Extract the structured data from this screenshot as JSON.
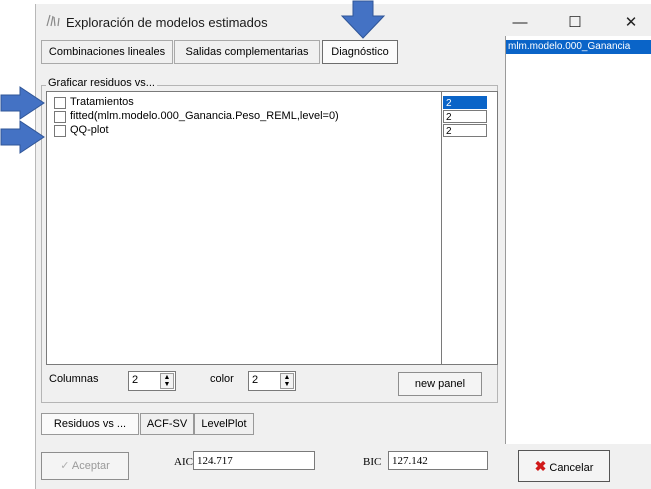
{
  "window": {
    "title": "Exploración de modelos estimados",
    "icon": "app-icon",
    "controls": {
      "minimize": "—",
      "maximize": "☐",
      "close": "✕"
    }
  },
  "tabs": [
    {
      "label": "Combinaciones lineales",
      "active": false
    },
    {
      "label": "Salidas complementarias",
      "active": false
    },
    {
      "label": "Diagnóstico",
      "active": true
    }
  ],
  "models_list": {
    "items": [
      "mlm.modelo.000_Ganancia"
    ],
    "selected_index": 0
  },
  "group": {
    "label": "Graficar residuos vs...",
    "items": [
      {
        "label": "Tratamientos",
        "checked": false
      },
      {
        "label": "fitted(mlm.modelo.000_Ganancia.Peso_REML,level=0)",
        "checked": false
      },
      {
        "label": "QQ-plot",
        "checked": false
      }
    ],
    "side_values": [
      "2",
      "2",
      "2"
    ]
  },
  "options": {
    "columnas_label": "Columnas",
    "columnas_value": "2",
    "color_label": "color",
    "color_value": "2",
    "new_panel_label": "new panel"
  },
  "bottom_tabs": [
    {
      "label": "Residuos vs ...",
      "active": true
    },
    {
      "label": "ACF-SV",
      "active": false
    },
    {
      "label": "LevelPlot",
      "active": false
    }
  ],
  "footer": {
    "accept_label": "Aceptar",
    "aic_label": "AIC",
    "aic_value": "124.717",
    "bic_label": "BIC",
    "bic_value": "127.142",
    "cancel_label": "Cancelar"
  },
  "colors": {
    "annotation_arrow": "#4472c4",
    "selection": "#0a64c8",
    "cancel_x": "#d01818"
  }
}
